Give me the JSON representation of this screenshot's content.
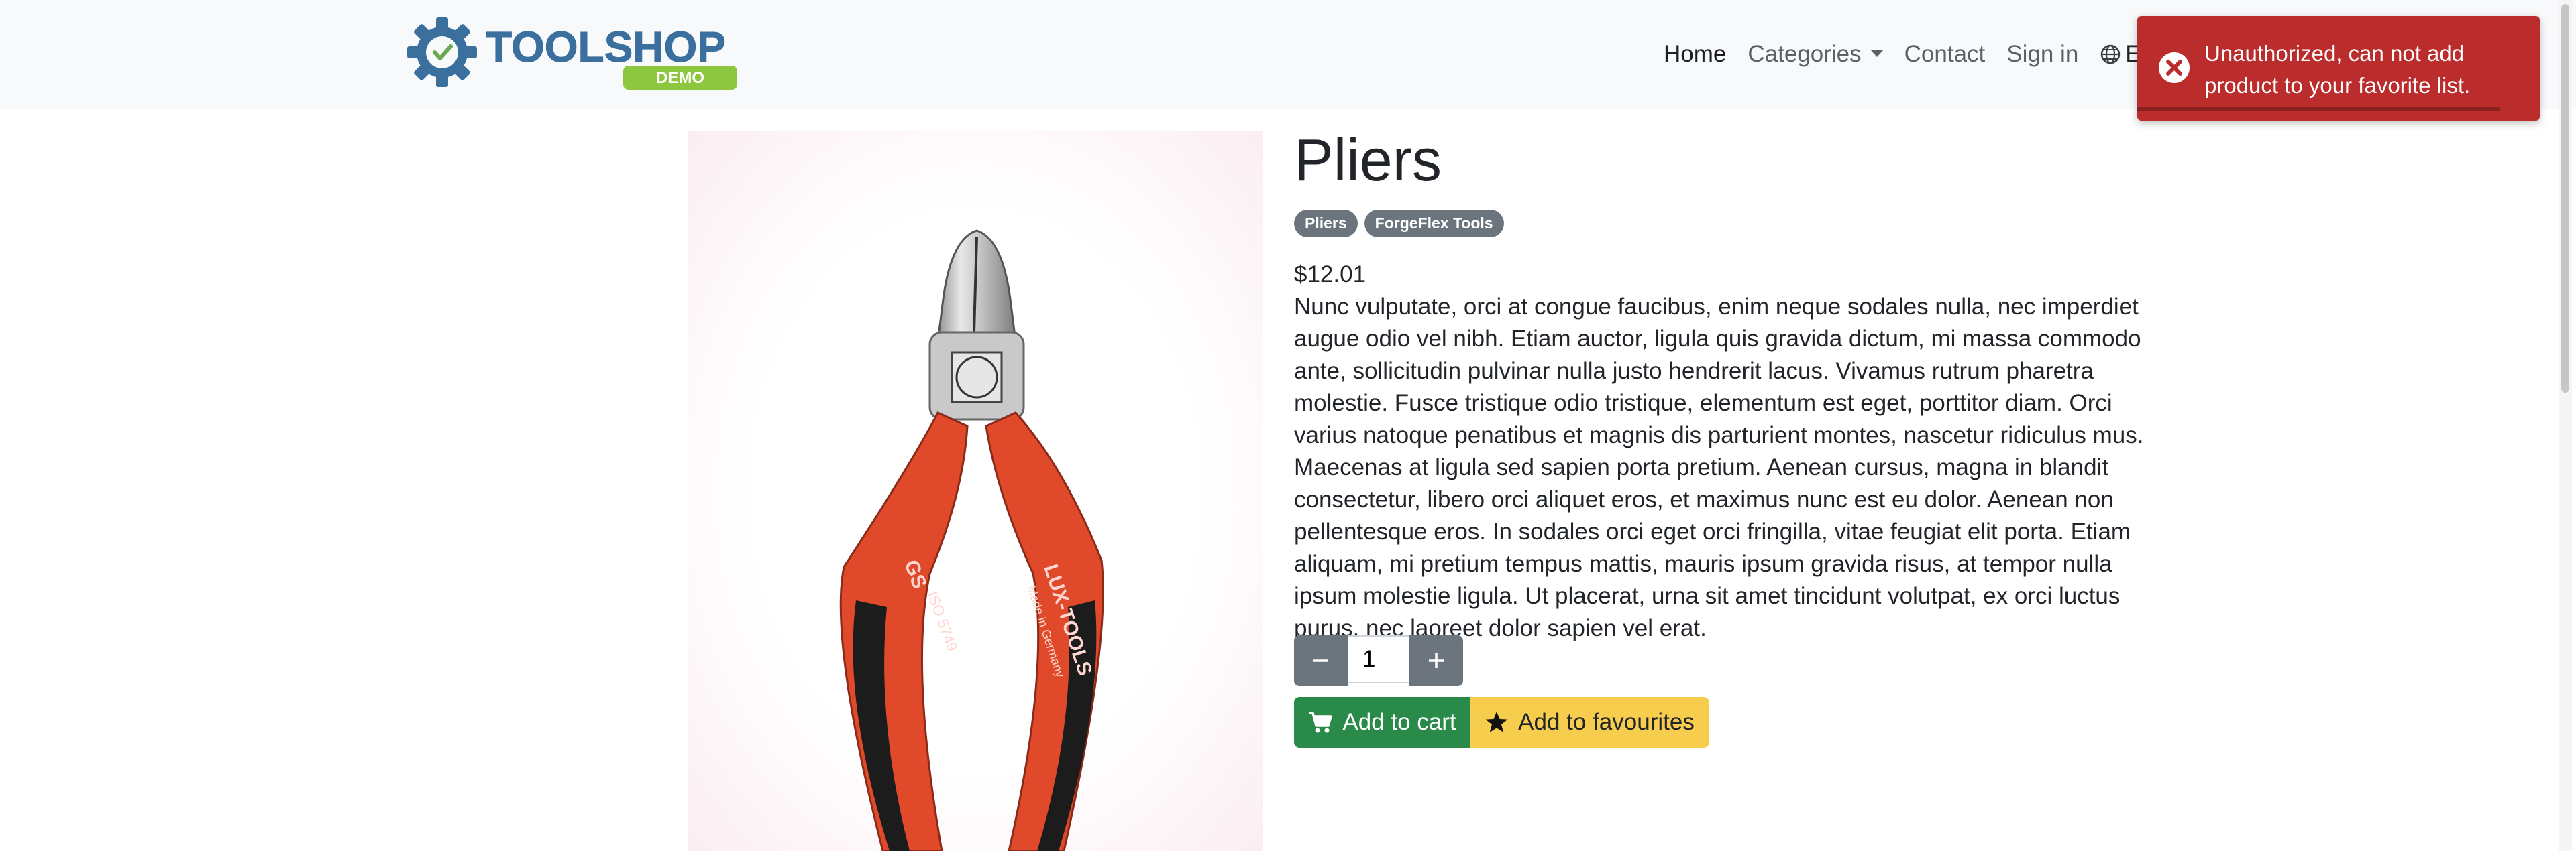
{
  "brand": {
    "logo_text": "TOOLSHOP",
    "logo_badge": "DEMO"
  },
  "nav": {
    "home": "Home",
    "categories": "Categories",
    "contact": "Contact",
    "sign_in": "Sign in",
    "language": "EN"
  },
  "toast": {
    "message": "Unauthorized, can not add product to your favorite list."
  },
  "product": {
    "name": "Pliers",
    "tags": [
      "Pliers",
      "ForgeFlex Tools"
    ],
    "price": "$12.01",
    "description": "Nunc vulputate, orci at congue faucibus, enim neque sodales nulla, nec imperdiet augue odio vel nibh. Etiam auctor, ligula quis gravida dictum, mi massa commodo ante, sollicitudin pulvinar nulla justo hendrerit lacus. Vivamus rutrum pharetra molestie. Fusce tristique odio tristique, elementum est eget, porttitor diam. Orci varius natoque penatibus et magnis dis parturient montes, nascetur ridiculus mus. Maecenas at ligula sed sapien porta pretium. Aenean cursus, magna in blandit consectetur, libero orci aliquet eros, et maximus nunc est eu dolor. Aenean non pellentesque eros. In sodales orci eget orci fringilla, vitae feugiat elit porta. Etiam aliquam, mi pretium tempus mattis, mauris ipsum gravida risus, at tempor nulla ipsum molestie ligula. Ut placerat, urna sit amet tincidunt volutpat, ex orci luctus purus, nec laoreet dolor sapien vel erat.",
    "image_text": {
      "brand": "LUX-TOOLS",
      "made_in": "Made in Germany",
      "gs": "GS",
      "iso": "ISO 5749"
    }
  },
  "quantity": {
    "value": "1"
  },
  "actions": {
    "add_to_cart": "Add to cart",
    "add_to_favourites": "Add to favourites"
  },
  "colors": {
    "toast_bg": "#bb2d2d",
    "cart_btn": "#2a8a4a",
    "fav_btn": "#f7cd4e",
    "badge": "#6c757d",
    "logo_gear": "#3a6f9e",
    "logo_badge": "#8dc63f"
  }
}
